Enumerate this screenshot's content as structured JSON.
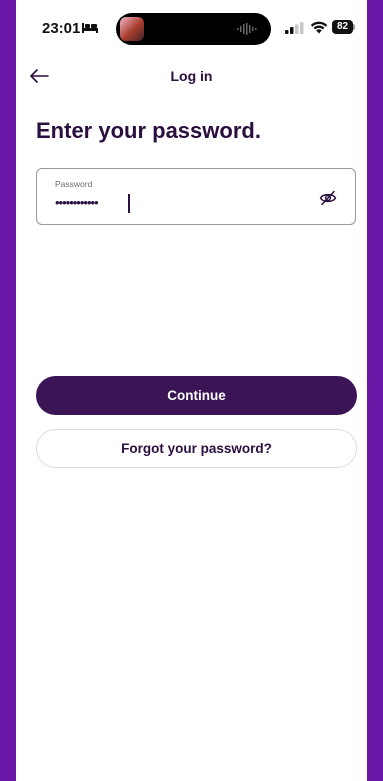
{
  "status_bar": {
    "time": "23:01",
    "battery": "82",
    "icons": [
      "bed-icon",
      "album-art",
      "audio-wave-icon",
      "signal-icon",
      "wifi-icon",
      "battery-icon"
    ]
  },
  "header": {
    "title": "Log in",
    "back_icon": "arrow-left-icon"
  },
  "main": {
    "heading": "Enter your password.",
    "password_field": {
      "label": "Password",
      "value": "••••••••••••",
      "toggle_icon": "eye-slash-icon"
    },
    "continue_label": "Continue",
    "forgot_label": "Forgot your password?"
  },
  "colors": {
    "frame": "#6a17a8",
    "primary": "#3b1456",
    "text_dark": "#2a0f3f"
  }
}
